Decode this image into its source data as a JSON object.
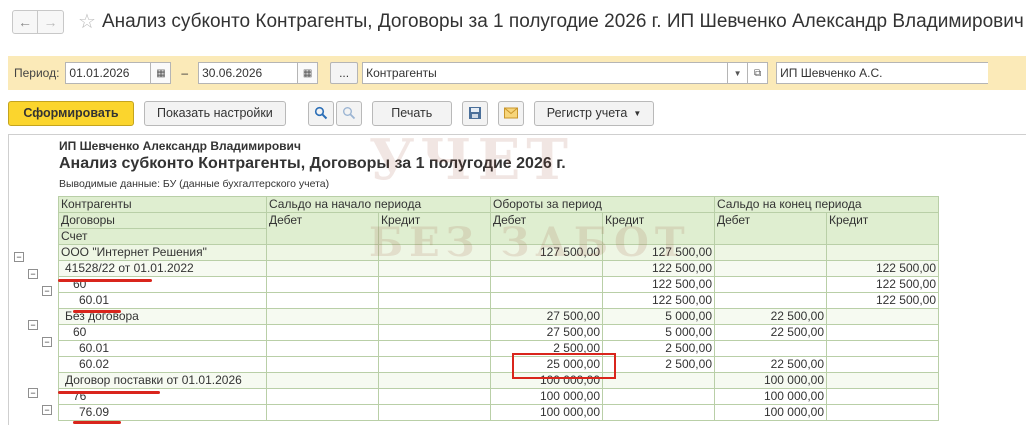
{
  "window": {
    "title": "Анализ субконто Контрагенты, Договоры за 1 полугодие 2026 г. ИП Шевченко Александр Владимирович"
  },
  "period_bar": {
    "label": "Период:",
    "date_from": "01.01.2026",
    "separator": "–",
    "date_to": "30.06.2026",
    "dots_label": "...",
    "subconto": "Контрагенты",
    "organization": "ИП Шевченко А.С."
  },
  "toolbar": {
    "generate": "Сформировать",
    "settings": "Показать настройки",
    "print": "Печать",
    "register": "Регистр учета"
  },
  "report": {
    "org_name": "ИП Шевченко Александр Владимирович",
    "title": "Анализ субконто Контрагенты, Договоры за 1 полугодие 2026 г.",
    "output": "Выводимые данные: БУ (данные бухгалтерского учета)",
    "headers": {
      "col1": [
        "Контрагенты",
        "Договоры",
        "Счет"
      ],
      "opening": "Сальдо на начало периода",
      "turnover": "Обороты за период",
      "closing": "Сальдо на конец периода",
      "debit": "Дебет",
      "credit": "Кредит"
    },
    "rows": [
      {
        "level": 0,
        "name": "ООО \"Интернет Решения\"",
        "od": "",
        "oc": "",
        "td": "127 500,00",
        "tc": "127 500,00",
        "cd": "",
        "cc": ""
      },
      {
        "level": 1,
        "name": "41528/22 от 01.01.2022",
        "od": "",
        "oc": "",
        "td": "",
        "tc": "122 500,00",
        "cd": "",
        "cc": "122 500,00"
      },
      {
        "level": 2,
        "name": "60",
        "od": "",
        "oc": "",
        "td": "",
        "tc": "122 500,00",
        "cd": "",
        "cc": "122 500,00"
      },
      {
        "level": 3,
        "name": "60.01",
        "od": "",
        "oc": "",
        "td": "",
        "tc": "122 500,00",
        "cd": "",
        "cc": "122 500,00"
      },
      {
        "level": 1,
        "name": "Без договора",
        "od": "",
        "oc": "",
        "td": "27 500,00",
        "tc": "5 000,00",
        "cd": "22 500,00",
        "cc": ""
      },
      {
        "level": 2,
        "name": "60",
        "od": "",
        "oc": "",
        "td": "27 500,00",
        "tc": "5 000,00",
        "cd": "22 500,00",
        "cc": ""
      },
      {
        "level": 3,
        "name": "60.01",
        "od": "",
        "oc": "",
        "td": "2 500,00",
        "tc": "2 500,00",
        "cd": "",
        "cc": ""
      },
      {
        "level": 3,
        "name": "60.02",
        "od": "",
        "oc": "",
        "td": "25 000,00",
        "tc": "2 500,00",
        "cd": "22 500,00",
        "cc": ""
      },
      {
        "level": 1,
        "name": "Договор поставки от 01.01.2026",
        "od": "",
        "oc": "",
        "td": "100 000,00",
        "tc": "",
        "cd": "100 000,00",
        "cc": ""
      },
      {
        "level": 2,
        "name": "76",
        "od": "",
        "oc": "",
        "td": "100 000,00",
        "tc": "",
        "cd": "100 000,00",
        "cc": ""
      },
      {
        "level": 3,
        "name": "76.09",
        "od": "",
        "oc": "",
        "td": "100 000,00",
        "tc": "",
        "cd": "100 000,00",
        "cc": ""
      }
    ]
  },
  "watermark": {
    "line1": "УЧЕТ",
    "line2": "БЕЗ ЗАБОТ"
  },
  "icons": [
    "back-arrow-icon",
    "forward-arrow-icon",
    "star-icon",
    "calendar-icon",
    "dropdown-arrow-icon",
    "open-icon",
    "search-icon",
    "search-next-icon",
    "save-icon",
    "email-icon"
  ],
  "colors": {
    "primary_button": "#fbd52d",
    "period_bar": "#fbeab8",
    "table_header": "#dfeed0",
    "annotation_red": "#d9251c"
  }
}
